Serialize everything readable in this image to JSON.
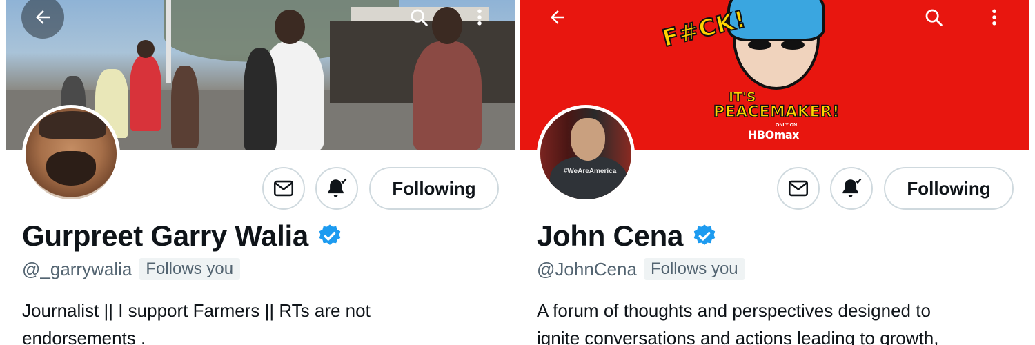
{
  "left_profile": {
    "banner": {
      "description_icon": "crowd-street-photo"
    },
    "back_icon": "arrow-left-icon",
    "search_icon": "search-icon",
    "more_icon": "more-vertical-icon",
    "message_icon": "mail-icon",
    "notify_icon": "bell-check-icon",
    "following_label": "Following",
    "name": "Gurpreet Garry Walia",
    "verified_icon": "verified-badge-icon",
    "handle": "@_garrywalia",
    "follows_you": "Follows you",
    "bio_line1": "Journalist || I support Farmers || RTs are not",
    "bio_line2": "endorsements ."
  },
  "right_profile": {
    "banner": {
      "poster_fck": "F#CK!",
      "poster_its": "IT'S",
      "poster_title": "PEACEMAKER!",
      "poster_only_on": "ONLY ON",
      "poster_brand": "HBOmax"
    },
    "back_icon": "arrow-left-icon",
    "search_icon": "search-icon",
    "more_icon": "more-vertical-icon",
    "avatar_shirt_text": "#WeAreAmerica",
    "message_icon": "mail-icon",
    "notify_icon": "bell-check-icon",
    "following_label": "Following",
    "name": "John Cena",
    "verified_icon": "verified-badge-icon",
    "handle": "@JohnCena",
    "follows_you": "Follows you",
    "bio_line1": "A forum of thoughts and perspectives designed to",
    "bio_line2": "ignite conversations and actions leading to growth,"
  },
  "colors": {
    "verified": "#1d9bf0",
    "text_primary": "#0f1419",
    "text_secondary": "#536471",
    "border": "#cfd9de",
    "right_banner": "#e8160f"
  }
}
